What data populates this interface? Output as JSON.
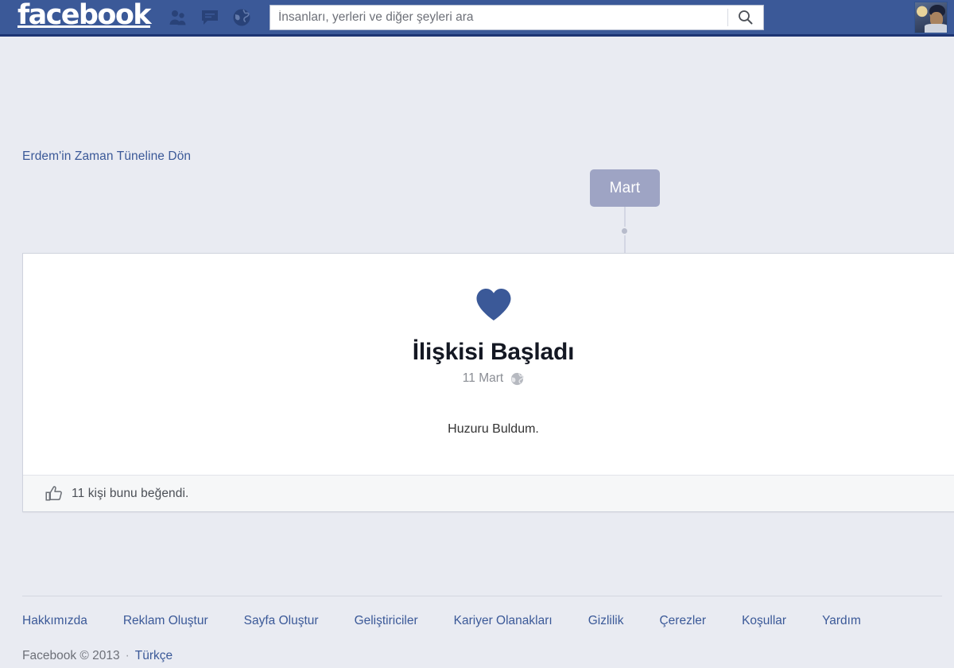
{
  "header": {
    "logo_text": "facebook",
    "nav_icons": [
      {
        "name": "friend-requests-icon",
        "label": "Arkadaşlık İstekleri"
      },
      {
        "name": "messages-icon",
        "label": "Mesajlar"
      },
      {
        "name": "notifications-icon",
        "label": "Bildirimler"
      }
    ],
    "search": {
      "placeholder": "İnsanları, yerleri ve diğer şeyleri ara",
      "value": "",
      "button_icon": "search-icon"
    },
    "avatar_alt": "Profil fotoğrafı",
    "bar_color": "#3b5998"
  },
  "page": {
    "back_link": "Erdem'in Zaman Tüneline Dön",
    "background_color": "#e9ebf2"
  },
  "timeline": {
    "month_pill": "Mart",
    "pill_color": "#9ea4c4"
  },
  "story": {
    "icon": "heart-icon",
    "icon_color": "#3b5998",
    "title": "İlişkisi Başladı",
    "date": "11 Mart",
    "privacy_icon": "globe-icon",
    "text": "Huzuru Buldum.",
    "likes": {
      "icon": "thumbs-up-icon",
      "text": "11 kişi bunu beğendi."
    }
  },
  "footer": {
    "links": [
      "Hakkımızda",
      "Reklam Oluştur",
      "Sayfa Oluştur",
      "Geliştiriciler",
      "Kariyer Olanakları",
      "Gizlilik",
      "Çerezler",
      "Koşullar",
      "Yardım"
    ],
    "copyright": "Facebook © 2013",
    "separator": "·",
    "language": "Türkçe"
  }
}
